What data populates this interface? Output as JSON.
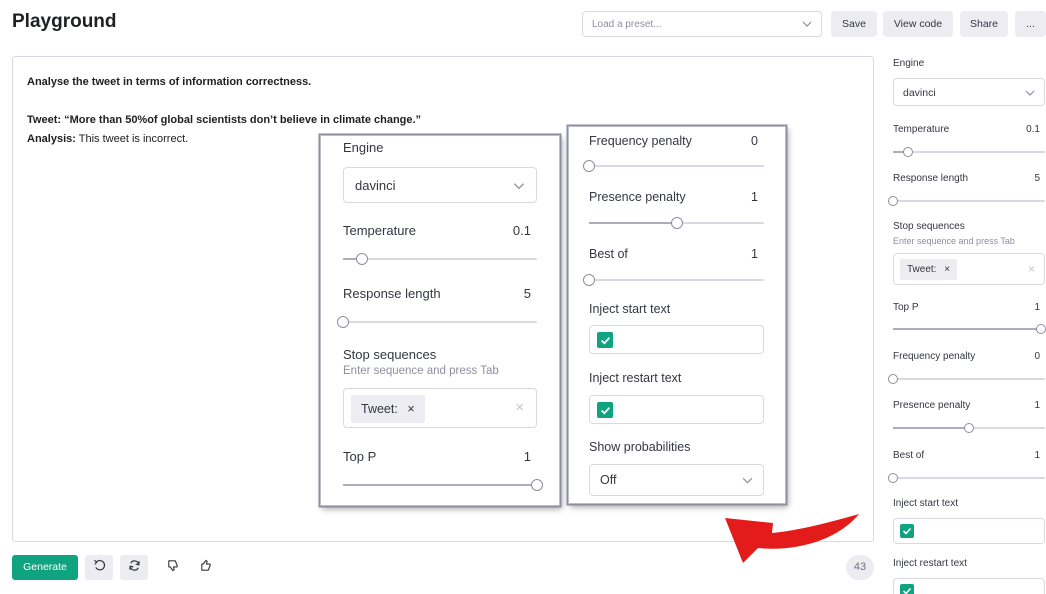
{
  "header": {
    "title": "Playground",
    "preset_placeholder": "Load a preset...",
    "save_label": "Save",
    "view_code_label": "View code",
    "share_label": "Share",
    "more_label": "..."
  },
  "editor": {
    "line1": "Analyse the tweet in terms of information correctness.",
    "tweet_label": "Tweet:",
    "tweet_text": " “More than 50%of global scientists don’t believe in climate change.”",
    "analysis_label": "Analysis:",
    "analysis_text": " This tweet is incorrect."
  },
  "footer": {
    "generate_label": "Generate",
    "token_count": "43"
  },
  "sidebar": {
    "engine_label": "Engine",
    "engine_value": "davinci",
    "temperature_label": "Temperature",
    "temperature_value": "0.1",
    "temperature_level": 0.1,
    "response_length_label": "Response length",
    "response_length_value": "5",
    "response_length_level": 0.0,
    "stop_sequences_label": "Stop sequences",
    "stop_sequences_hint": "Enter sequence and press Tab",
    "stop_tag": "Tweet:",
    "top_p_label": "Top P",
    "top_p_value": "1",
    "top_p_level": 1.0,
    "frequency_penalty_label": "Frequency penalty",
    "frequency_penalty_value": "0",
    "frequency_penalty_level": 0.0,
    "presence_penalty_label": "Presence penalty",
    "presence_penalty_value": "1",
    "presence_penalty_level": 0.5,
    "best_of_label": "Best of",
    "best_of_value": "1",
    "best_of_level": 0.0,
    "inject_start_label": "Inject start text",
    "inject_start_checked": true,
    "inject_restart_label": "Inject restart text",
    "inject_restart_checked": true,
    "show_probabilities_label": "Show probabilities",
    "show_probabilities_value": "Off"
  },
  "colors": {
    "accent": "#10a37f",
    "arrow": "#e31b1b"
  },
  "icons": {
    "preset": "chevron-down-icon",
    "undo": "undo-icon",
    "regenerate": "regenerate-icon",
    "dislike": "thumbs-down-icon",
    "like": "thumbs-up-icon"
  }
}
